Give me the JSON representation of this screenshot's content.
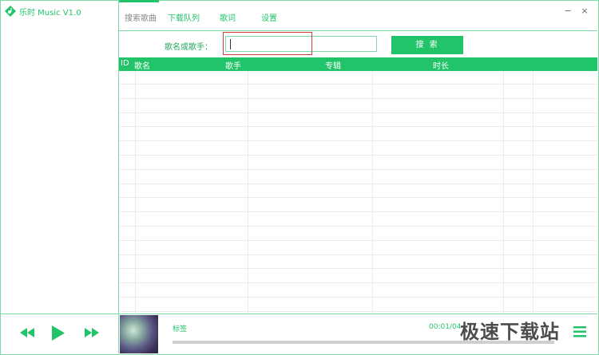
{
  "app": {
    "title": "乐时 Music V1.0"
  },
  "tabs": [
    {
      "label": "搜索歌曲",
      "active": true
    },
    {
      "label": "下载队列",
      "active": false
    },
    {
      "label": "歌词",
      "active": false
    },
    {
      "label": "设置",
      "active": false
    }
  ],
  "window": {
    "minimize": "−",
    "close": "×"
  },
  "search": {
    "label": "歌名或歌手：",
    "value": "",
    "button_label": "搜 索"
  },
  "table": {
    "headers": [
      "ID",
      "歌名",
      "歌手",
      "专辑",
      "时长"
    ],
    "rows": []
  },
  "player": {
    "track_label": "标签",
    "time": "00:01/04",
    "progress": 0
  },
  "watermark": "极速下载站",
  "colors": {
    "accent": "#22c46a",
    "border": "#7fd9a8",
    "highlight": "#cf3b3b"
  },
  "icons": [
    "app-logo-icon",
    "previous-icon",
    "play-icon",
    "next-icon",
    "playlist-icon"
  ]
}
